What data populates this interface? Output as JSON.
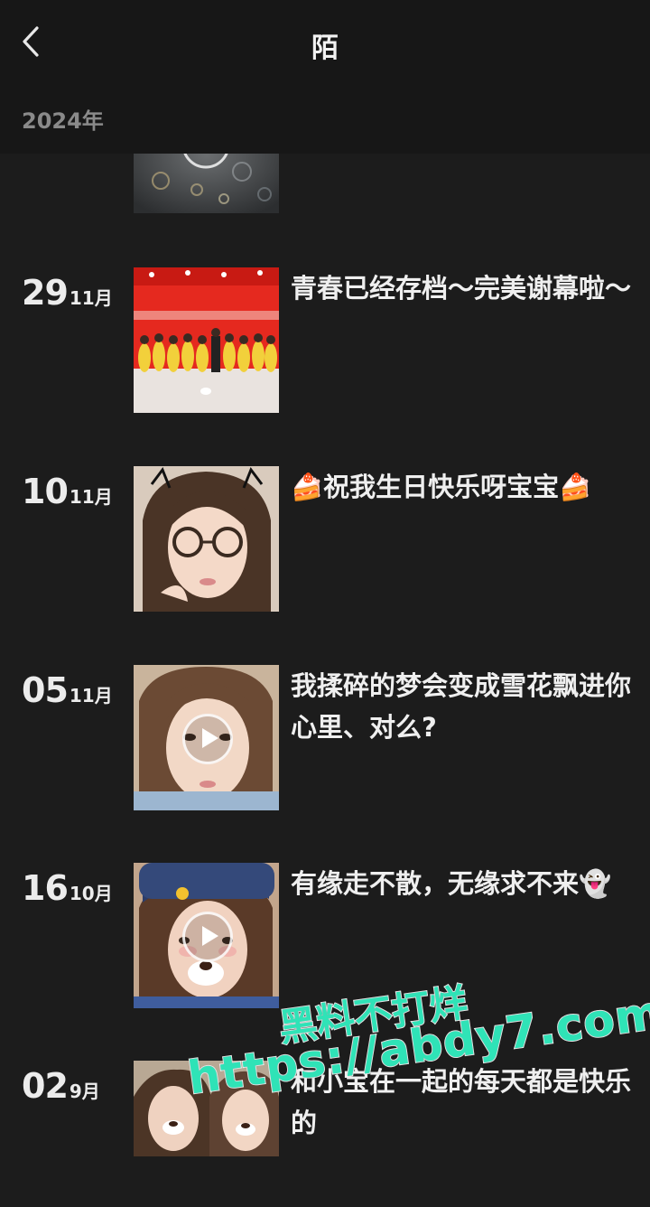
{
  "header": {
    "title": "陌",
    "year": "2024年",
    "back_icon": "chevron-left-icon"
  },
  "posts": [
    {
      "day": "29",
      "month": "11月",
      "caption": "青春已经存档～完美谢幕啦～",
      "has_play": false
    },
    {
      "day": "10",
      "month": "11月",
      "caption": "🍰祝我生日快乐呀宝宝🍰",
      "has_play": false
    },
    {
      "day": "05",
      "month": "11月",
      "caption": "我揉碎的梦会变成雪花飘进你心里、对么?",
      "has_play": true
    },
    {
      "day": "16",
      "month": "10月",
      "caption": "有缘走不散，无缘求不来👻",
      "has_play": true
    },
    {
      "day": "02",
      "month": "9月",
      "caption": "和小宝在一起的每天都是快乐的",
      "has_play": false
    }
  ],
  "watermark": {
    "line1": "黑料不打烊",
    "line2": "https://abdy7.com",
    "color": "#2fe3b7"
  }
}
